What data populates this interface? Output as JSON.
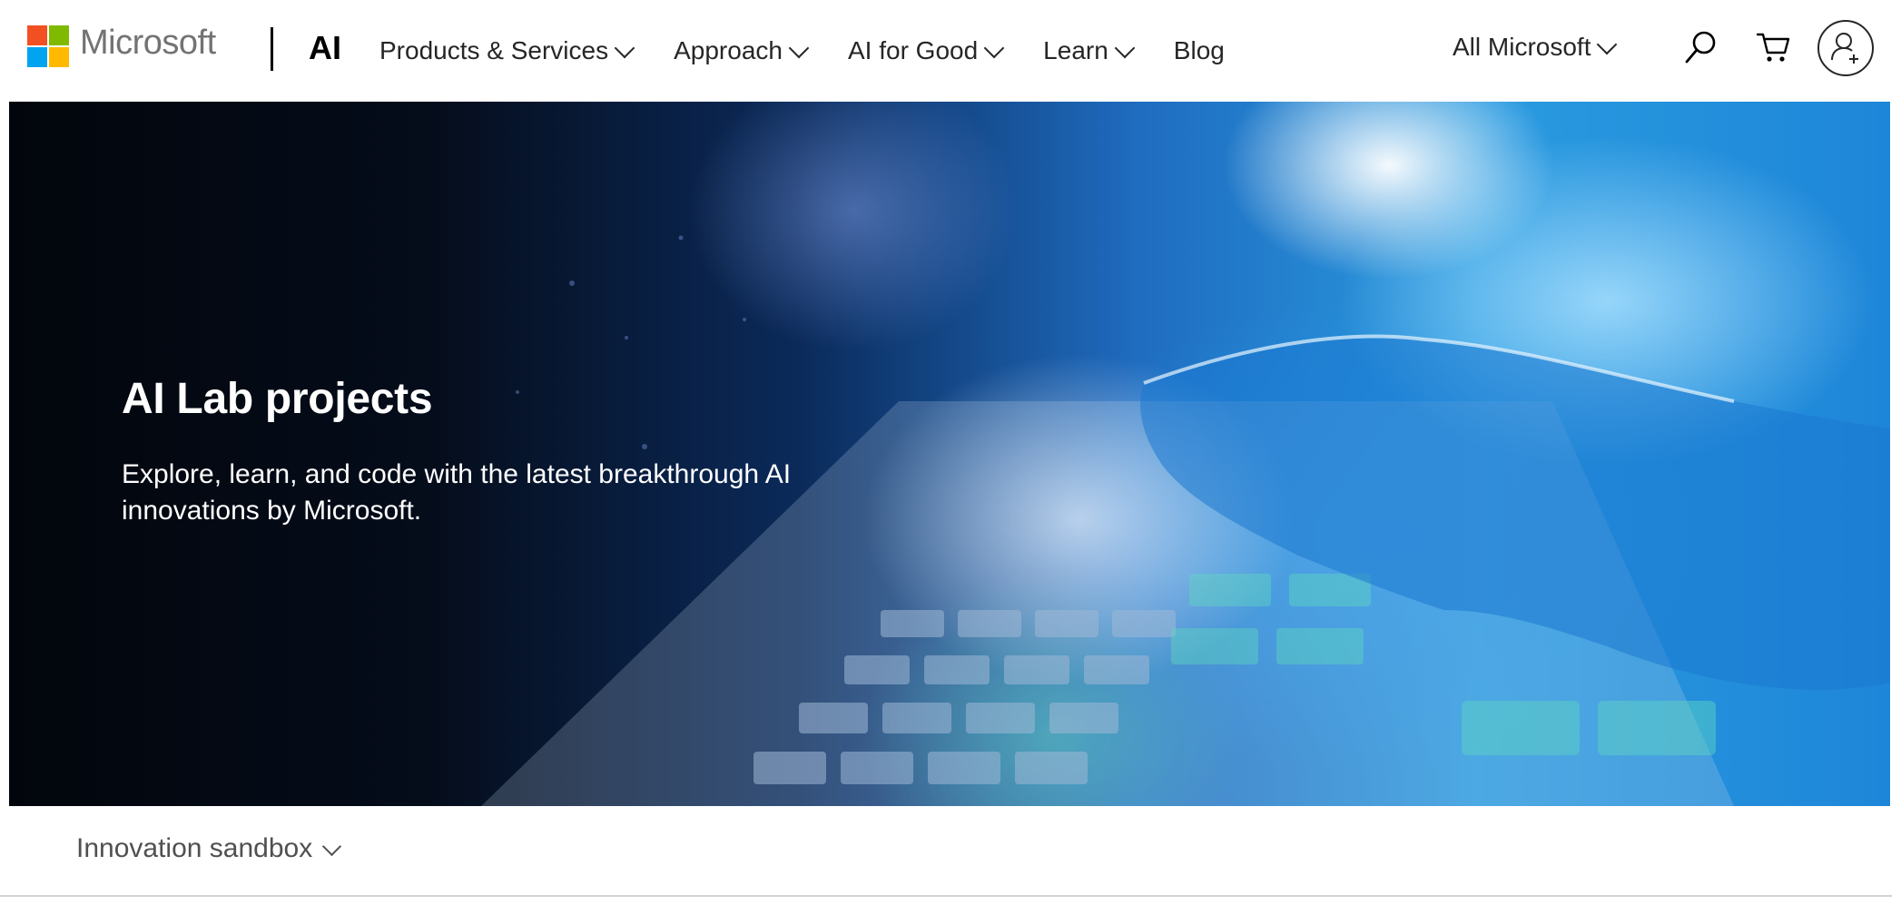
{
  "header": {
    "brand": "Microsoft",
    "section_title": "AI",
    "logo_colors": [
      "#f25022",
      "#7fba00",
      "#00a4ef",
      "#ffb900"
    ],
    "nav": [
      {
        "label": "Products & Services",
        "has_dropdown": true
      },
      {
        "label": "Approach",
        "has_dropdown": true
      },
      {
        "label": "AI for Good",
        "has_dropdown": true
      },
      {
        "label": "Learn",
        "has_dropdown": true
      },
      {
        "label": "Blog",
        "has_dropdown": false
      }
    ],
    "all_microsoft": "All Microsoft",
    "icons": [
      "search-icon",
      "cart-icon",
      "profile-icon"
    ]
  },
  "hero": {
    "title": "AI Lab projects",
    "description": "Explore, learn, and code with the latest breakthrough AI innovations by Microsoft."
  },
  "subnav": {
    "label": "Innovation sandbox"
  }
}
